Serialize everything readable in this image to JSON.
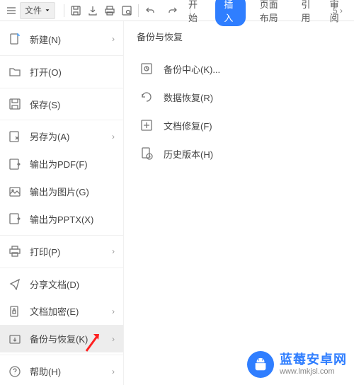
{
  "toolbar": {
    "file_label": "文件"
  },
  "tabs": {
    "start": "开始",
    "insert": "插入",
    "layout": "页面布局",
    "ref": "引用",
    "review": "审阅"
  },
  "overflow_hint": "5",
  "menu": {
    "new": "新建(N)",
    "open": "打开(O)",
    "save": "保存(S)",
    "saveas": "另存为(A)",
    "exportpdf": "输出为PDF(F)",
    "exportimg": "输出为图片(G)",
    "exportppt": "输出为PPTX(X)",
    "print": "打印(P)",
    "share": "分享文档(D)",
    "encrypt": "文档加密(E)",
    "backup": "备份与恢复(K)",
    "help": "帮助(H)"
  },
  "submenu": {
    "title": "备份与恢复",
    "backup_center": "备份中心(K)...",
    "data_restore": "数据恢复(R)",
    "doc_repair": "文档修复(F)",
    "history": "历史版本(H)"
  },
  "watermark": {
    "title": "蓝莓安卓网",
    "url": "www.lmkjsl.com"
  }
}
